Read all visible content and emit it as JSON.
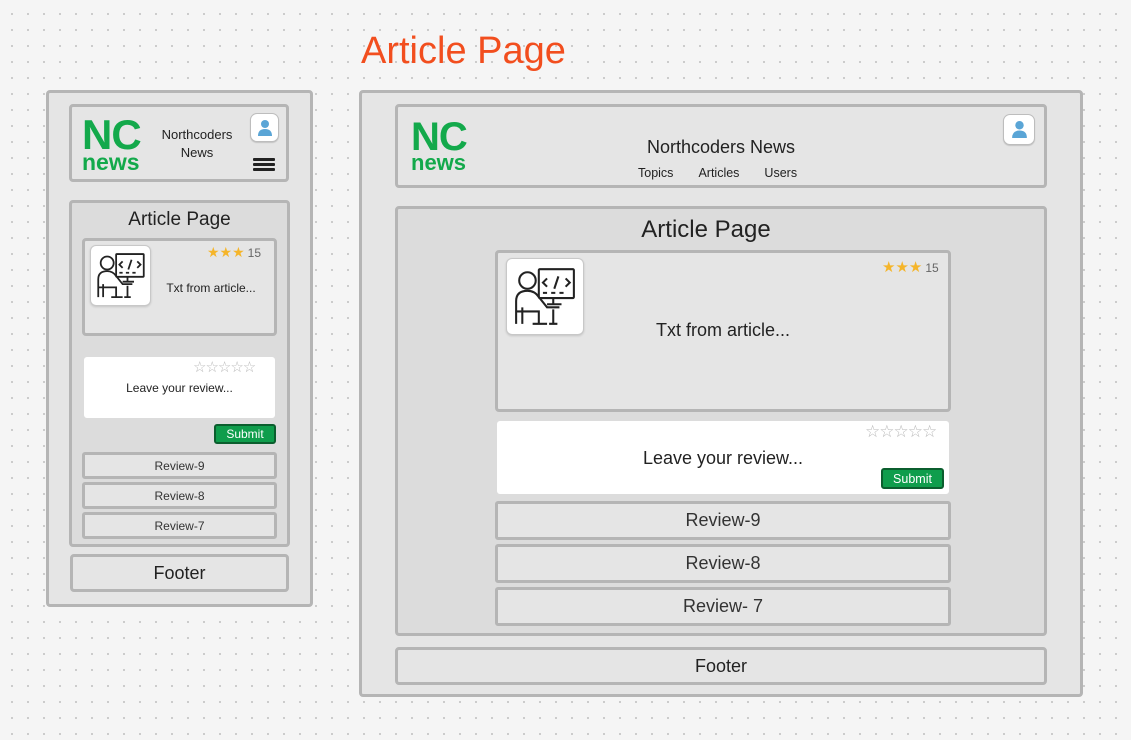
{
  "board_title": "Article Page",
  "colors": {
    "brand_green": "#13a94b",
    "title_orange": "#f24e1e",
    "star_gold": "#f5b52a",
    "submit_green": "#0f9d4c"
  },
  "mobile": {
    "logo": {
      "top": "NC",
      "bottom": "news"
    },
    "site_name_line1": "Northcoders",
    "site_name_line2": "News",
    "avatar_icon": "user-icon",
    "menu_icon": "hamburger-icon",
    "page_heading": "Article Page",
    "article": {
      "rating_stars": "★★★",
      "rating_count": "15",
      "text": "Txt from article...",
      "thumbnail_icon": "developer-icon"
    },
    "review_form": {
      "empty_stars": "☆☆☆☆☆",
      "placeholder": "Leave your review...",
      "submit_label": "Submit"
    },
    "reviews": [
      "Review-9",
      "Review-8",
      "Review-7"
    ],
    "footer": "Footer"
  },
  "desktop": {
    "logo": {
      "top": "NC",
      "bottom": "news"
    },
    "site_name": "Northcoders News",
    "nav": [
      "Topics",
      "Articles",
      "Users"
    ],
    "avatar_icon": "user-icon",
    "page_heading": "Article Page",
    "article": {
      "rating_stars": "★★★",
      "rating_count": "15",
      "text": "Txt from article...",
      "thumbnail_icon": "developer-icon"
    },
    "review_form": {
      "empty_stars": "☆☆☆☆☆",
      "placeholder": "Leave your review...",
      "submit_label": "Submit"
    },
    "reviews": [
      "Review-9",
      "Review-8",
      "Review- 7"
    ],
    "footer": "Footer"
  }
}
